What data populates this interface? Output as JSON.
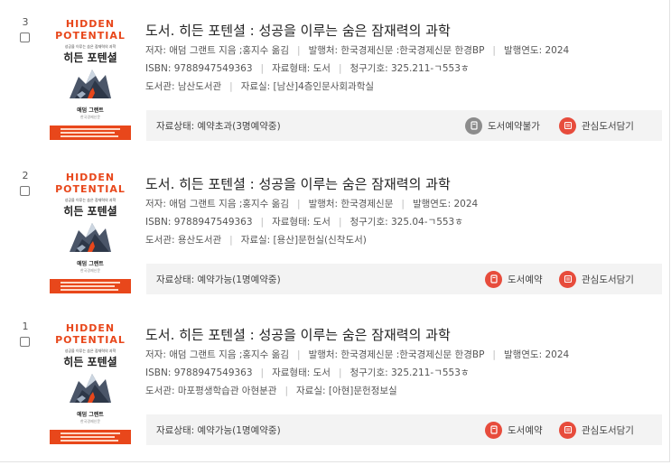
{
  "results": [
    {
      "rank": "3",
      "title": "도서. 히든 포텐셜 : 성공을 이루는 숨은 잠재력의 과학",
      "author": "저자: 애덤 그랜트 지음 ;홍지수 옮김",
      "publisher": "발행처: 한국경제신문 :한국경제신문 한경BP",
      "year": "발행연도: 2024",
      "isbn": "ISBN: 9788947549363",
      "form": "자료형태: 도서",
      "call_no": "청구기호: 325.211-ㄱ553ㅎ",
      "library": "도서관: 남산도서관",
      "room": "자료실: [남산]4층인문사회과학실",
      "status": "자료상태: 예약초과(3명예약중)",
      "reserve_label": "도서예약불가",
      "reserve_enabled": false,
      "fav_label": "관심도서담기"
    },
    {
      "rank": "2",
      "title": "도서. 히든 포텐셜 : 성공을 이루는 숨은 잠재력의 과학",
      "author": "저자: 애덤 그랜트 지음 ;홍지수 옮김",
      "publisher": "발행처: 한국경제신문",
      "year": "발행연도: 2024",
      "isbn": "ISBN: 9788947549363",
      "form": "자료형태: 도서",
      "call_no": "청구기호: 325.04-ㄱ553ㅎ",
      "library": "도서관: 용산도서관",
      "room": "자료실: [용산]문헌실(신착도서)",
      "status": "자료상태: 예약가능(1명예약중)",
      "reserve_label": "도서예약",
      "reserve_enabled": true,
      "fav_label": "관심도서담기"
    },
    {
      "rank": "1",
      "title": "도서. 히든 포텐셜 : 성공을 이루는 숨은 잠재력의 과학",
      "author": "저자: 애덤 그랜트 지음 ;홍지수 옮김",
      "publisher": "발행처: 한국경제신문 :한국경제신문 한경BP",
      "year": "발행연도: 2024",
      "isbn": "ISBN: 9788947549363",
      "form": "자료형태: 도서",
      "call_no": "청구기호: 325.211-ㄱ553ㅎ",
      "library": "도서관: 마포평생학습관 아현분관",
      "room": "자료실: [아현]문헌정보실",
      "status": "자료상태: 예약가능(1명예약중)",
      "reserve_label": "도서예약",
      "reserve_enabled": true,
      "fav_label": "관심도서담기"
    }
  ],
  "cover": {
    "title_line1": "HIDDEN",
    "title_line2": "POTENTIAL",
    "subtitle": "성공을 이루는 숨은 잠재력의 과학",
    "title_ko": "히든 포텐셜",
    "author": "애덤 그랜트",
    "publisher": "한국경제신문"
  },
  "colors": {
    "accent": "#e74c3c",
    "cover_orange": "#e8471b",
    "disabled": "#8c8c8c",
    "status_bg": "#f3f3f3"
  },
  "icons": {
    "reserve": "book-icon",
    "favorite": "list-icon"
  }
}
